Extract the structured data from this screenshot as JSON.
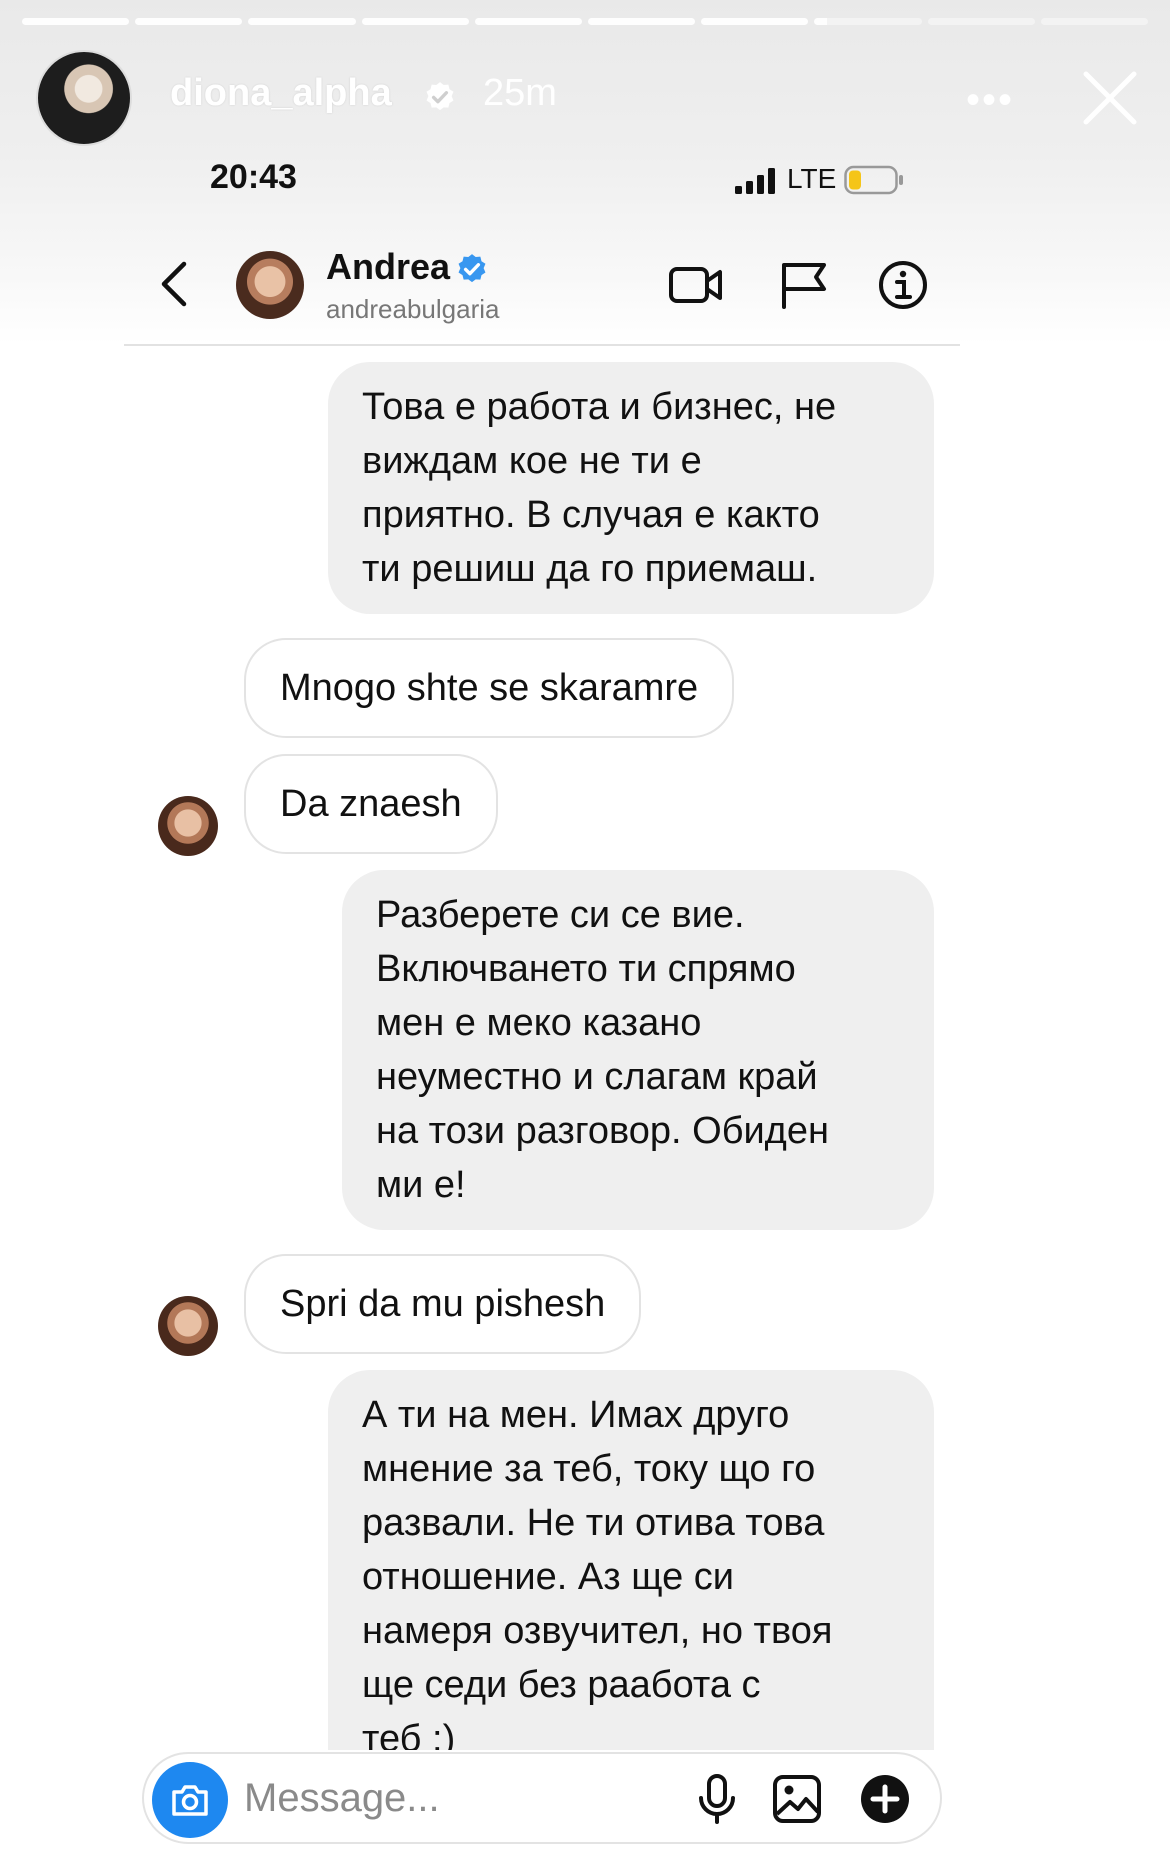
{
  "story": {
    "username": "diona_alpha",
    "posted_ago": "25m",
    "progress_segments": 10,
    "active_segment": 7,
    "active_progress": 0.12
  },
  "status_bar": {
    "time": "20:43",
    "network": "LTE"
  },
  "chat_header": {
    "name": "Andrea",
    "handle": "andreabulgaria"
  },
  "messages": [
    {
      "direction": "sent",
      "text": "Това е работа и бизнес, не\nвиждам кое не ти е\nприятно. В случая е както\nти решиш да го приемаш."
    },
    {
      "direction": "received",
      "text": "Mnogo shte se skaramre"
    },
    {
      "direction": "received",
      "text": "Da znaesh"
    },
    {
      "direction": "sent",
      "text": "Разберете си се вие.\nВключването ти спрямо\nмен е меко казано\nнеуместно и слагам край\nна този разговор. Обиден\nми е!"
    },
    {
      "direction": "received",
      "text": "Spri da mu pishesh"
    },
    {
      "direction": "sent",
      "text": "А ти на мен. Имах друго\nмнение за теб, току що го\nразвали. Не ти отива това\nотношение. Аз ще си\nнамеря озвучител, но твоя\nще седи без раабота с\nтеб :)"
    }
  ],
  "composer": {
    "placeholder": "Message..."
  },
  "colors": {
    "accent_blue": "#1e88f0",
    "verified_blue": "#3897f0",
    "bubble_sent": "#efefef"
  },
  "icons": [
    "close-icon",
    "more-icon",
    "back-icon",
    "video-call-icon",
    "flag-icon",
    "info-icon",
    "camera-icon",
    "microphone-icon",
    "gallery-icon",
    "plus-icon",
    "verified-badge-icon"
  ]
}
